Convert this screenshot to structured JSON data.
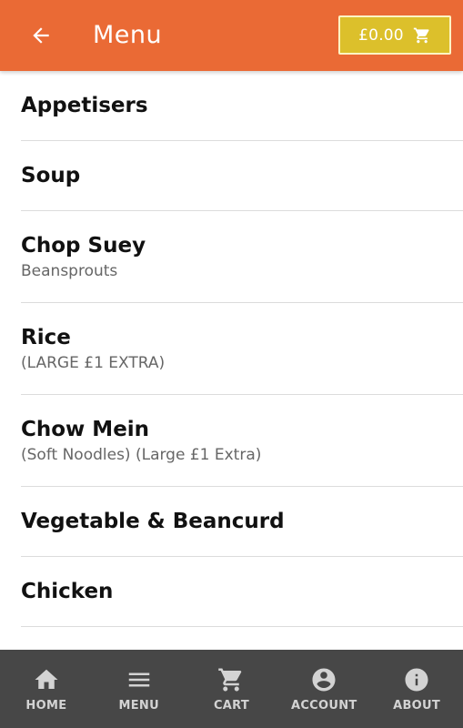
{
  "header": {
    "title": "Menu",
    "back_icon": "arrow-left-icon",
    "cart_total": "£0.00",
    "cart_icon": "shopping-cart-icon"
  },
  "colors": {
    "header_bg": "#ea6a35",
    "cart_button_bg": "#dcc02b",
    "bottom_nav_bg": "#474747",
    "nav_label": "#d3d3d3"
  },
  "categories": [
    {
      "name": "Appetisers",
      "description": ""
    },
    {
      "name": "Soup",
      "description": ""
    },
    {
      "name": "Chop Suey",
      "description": "Beansprouts"
    },
    {
      "name": "Rice",
      "description": "(LARGE £1 EXTRA)"
    },
    {
      "name": "Chow Mein",
      "description": "(Soft Noodles) (Large £1 Extra)"
    },
    {
      "name": "Vegetable & Beancurd",
      "description": ""
    },
    {
      "name": "Chicken",
      "description": ""
    }
  ],
  "bottom_nav": [
    {
      "label": "HOME",
      "icon": "home-icon"
    },
    {
      "label": "MENU",
      "icon": "menu-icon"
    },
    {
      "label": "CART",
      "icon": "cart-icon"
    },
    {
      "label": "ACCOUNT",
      "icon": "account-icon"
    },
    {
      "label": "ABOUT",
      "icon": "info-icon"
    }
  ]
}
